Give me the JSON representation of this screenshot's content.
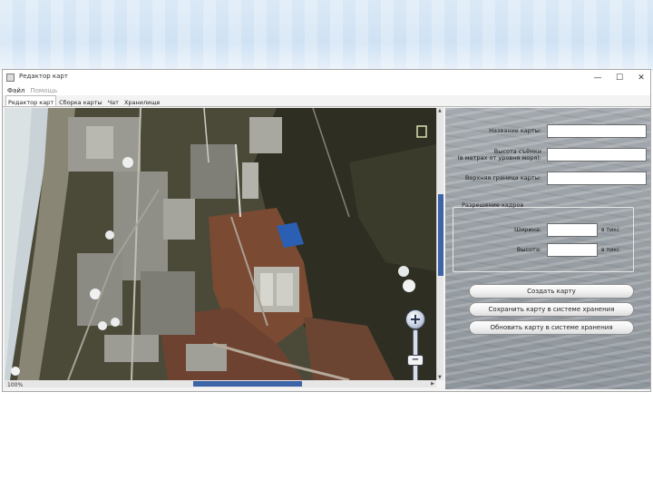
{
  "window": {
    "title": "Редактор карт",
    "controls": {
      "minimize": "—",
      "maximize": "☐",
      "close": "✕"
    }
  },
  "menu": [
    {
      "label": "Файл",
      "enabled": true
    },
    {
      "label": "Помощь",
      "enabled": false
    }
  ],
  "tabs": [
    {
      "label": "Редактор карт",
      "active": true
    },
    {
      "label": "Сборка карты",
      "active": false
    },
    {
      "label": "Чат",
      "active": false
    },
    {
      "label": "Хранилище",
      "active": false
    }
  ],
  "map": {
    "scale_readout": "100%",
    "zoom_in_symbol": "+",
    "zoom_out_symbol": "−",
    "zoom_slider_symbol": "−",
    "zoom_level_fraction": 0.45,
    "vertical_scroll_fraction": 0.45,
    "horizontal_scroll_fraction": 0.6,
    "colors": {
      "sea": "#cfd8dc",
      "terrain_dark": "#3b3a2c",
      "soil": "#7a4a33",
      "concrete": "#8d8e88",
      "roof_blue": "#2b5fb3"
    }
  },
  "form": {
    "map_name_label": "Название карты:",
    "map_name_value": "",
    "shoot_height_label": "Высота съёмки\n(в метрах от уровня моря):",
    "shoot_height_value": "",
    "top_bound_label": "Верхняя граница карты:",
    "top_bound_value": "",
    "resolution_group": "Разрешение кадров",
    "width_label": "Ширина:",
    "width_value": "",
    "width_unit": "в пикс",
    "height_label": "Высота:",
    "height_value": "",
    "height_unit": "в пикс"
  },
  "buttons": {
    "create_map": "Создать карту",
    "save_map": "Сохранить карту в системе хранения",
    "update_map": "Обновить карту в системе хранения"
  },
  "colors": {
    "scroll_thumb": "#3e64a8",
    "panel_bg": "#9aa0a5"
  }
}
